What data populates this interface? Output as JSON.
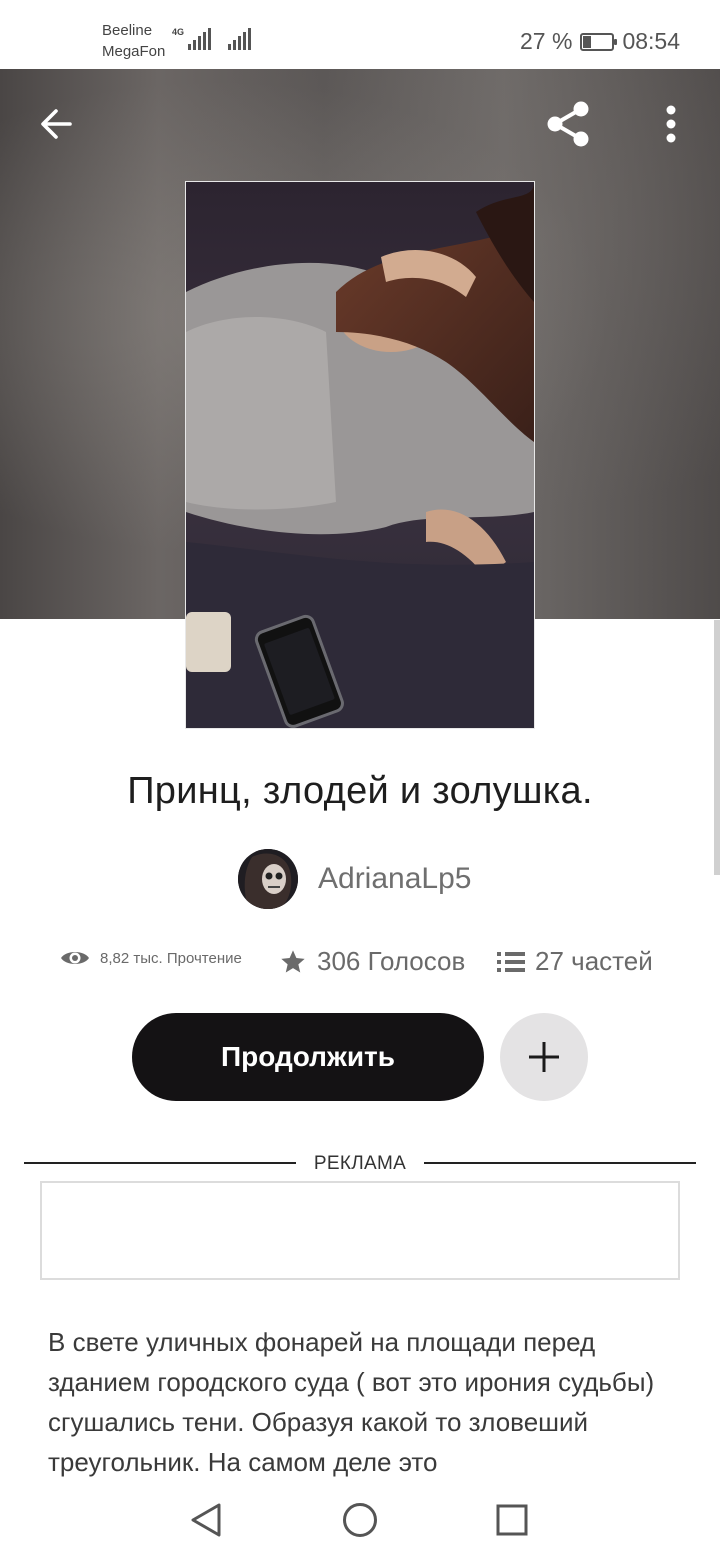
{
  "status_bar": {
    "carrier1": "Beeline",
    "carrier2": "MegaFon",
    "network": "4G",
    "battery_percent": "27 %",
    "battery_level": 0.27,
    "time": "08:54"
  },
  "header": {
    "icons": [
      "arrow-left-icon",
      "share-icon",
      "more-vertical-icon"
    ]
  },
  "story": {
    "title": "Принц, злодей и золушка.",
    "author": "AdrianaLp5",
    "stats": {
      "reads": "8,82 тыс. Прочтение",
      "votes": "306 Голосов",
      "parts": "27 частей"
    }
  },
  "actions": {
    "continue_label": "Продолжить",
    "add_icon": "plus-icon"
  },
  "ad": {
    "label": "РЕКЛАМА"
  },
  "description": {
    "text": "В свете уличных фонарей на площади перед зданием городского суда ( вот это ирония судьбы) сгушались тени. Образуя какой то зловеший треугольник. На самом деле это"
  },
  "navbar": {
    "icons": [
      "back-triangle-icon",
      "home-circle-icon",
      "recents-square-icon"
    ]
  },
  "colors": {
    "button_dark": "#141214",
    "add_button_bg": "#e4e3e4",
    "text_gray": "#6f6f6f"
  }
}
